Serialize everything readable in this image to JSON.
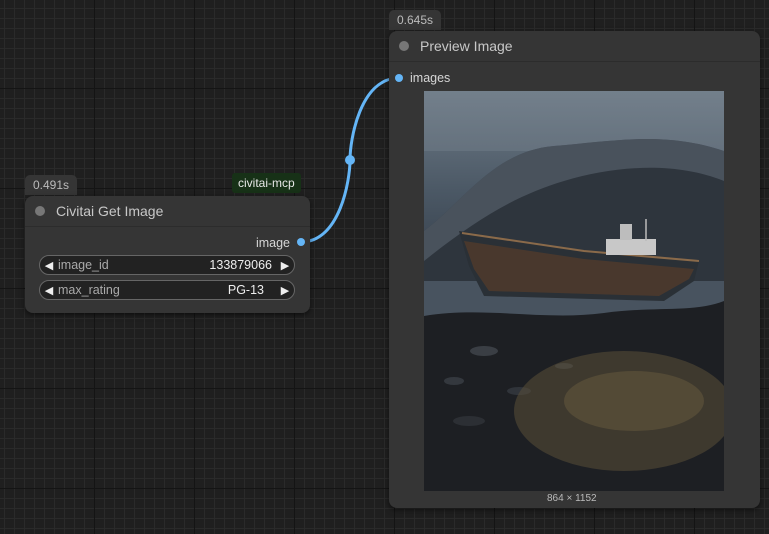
{
  "nodes": {
    "civitai": {
      "timing": "0.491s",
      "title": "Civitai Get Image",
      "source_tag": "civitai-mcp",
      "output_label": "image",
      "widgets": [
        {
          "label": "image_id",
          "value": "133879066"
        },
        {
          "label": "max_rating",
          "value": "PG-13"
        }
      ]
    },
    "preview": {
      "timing": "0.645s",
      "title": "Preview Image",
      "input_label": "images",
      "image_dims": "864 × 1152"
    }
  },
  "colors": {
    "link": "#64b5f6",
    "node_bg": "#353535",
    "tag_bg": "#173117"
  },
  "icons": {
    "decrement": "◀",
    "increment": "▶"
  }
}
